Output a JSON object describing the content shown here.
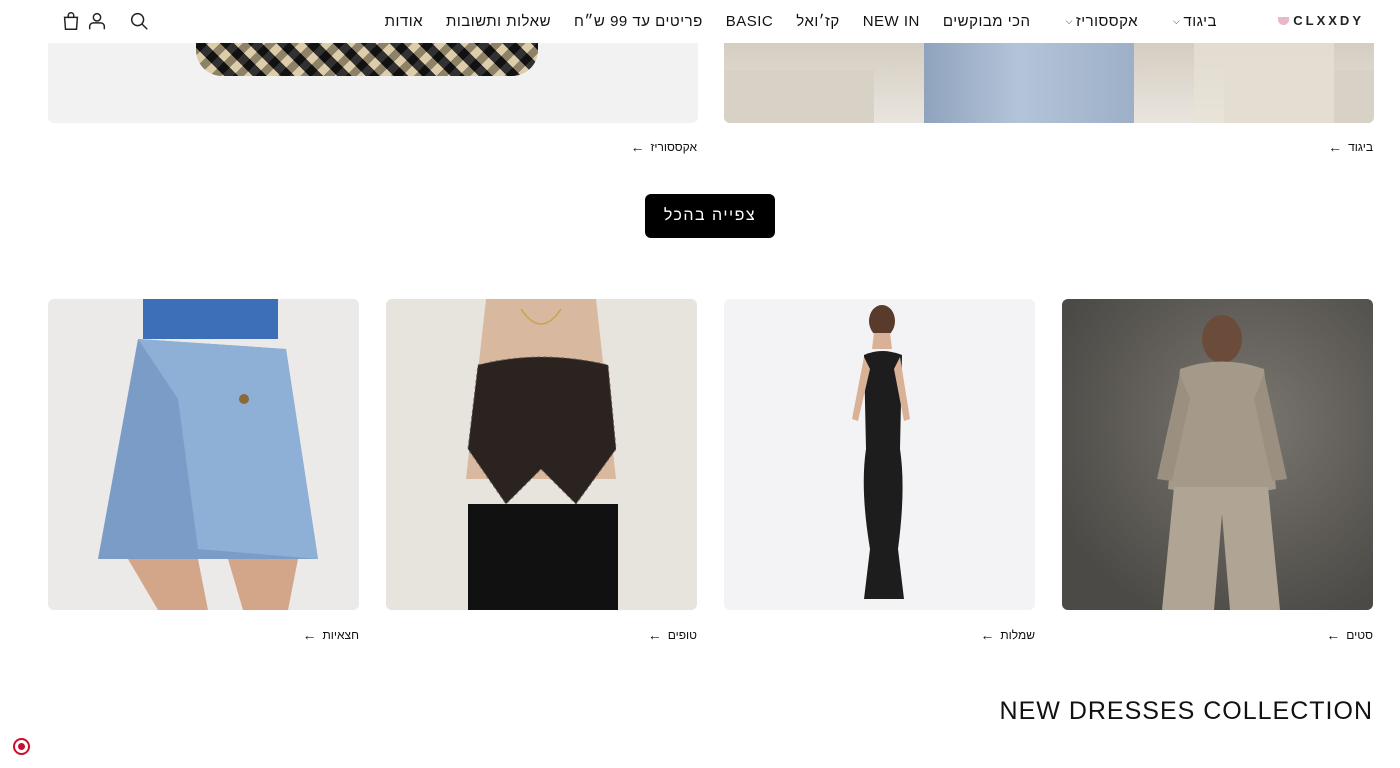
{
  "header": {
    "logo_text": "CLXXDY",
    "nav": [
      {
        "label": "ביגוד",
        "has_dropdown": true
      },
      {
        "label": "אקססוריז",
        "has_dropdown": true
      },
      {
        "label": "הכי מבוקשים",
        "has_dropdown": false
      },
      {
        "label": "NEW IN",
        "has_dropdown": false
      },
      {
        "label": "קז׳ואל",
        "has_dropdown": false
      },
      {
        "label": "BASIC",
        "has_dropdown": false
      },
      {
        "label": "פריטים עד 99 ש״ח",
        "has_dropdown": false
      },
      {
        "label": "שאלות ותשובות",
        "has_dropdown": false
      },
      {
        "label": "אודות",
        "has_dropdown": false
      }
    ],
    "icons": [
      "search-icon",
      "account-icon",
      "cart-icon"
    ]
  },
  "top_banners": [
    {
      "label": "ביגוד"
    },
    {
      "label": "אקססוריז"
    }
  ],
  "view_all_label": "צפייה בהכל",
  "category_cards": [
    {
      "label": "סטים"
    },
    {
      "label": "שמלות"
    },
    {
      "label": "טופים"
    },
    {
      "label": "חצאיות"
    }
  ],
  "section_title": "NEW DRESSES COLLECTION",
  "colors": {
    "accent": "#000000",
    "logo_mark": "#e9b7c8",
    "a11y": "#c8102e"
  }
}
